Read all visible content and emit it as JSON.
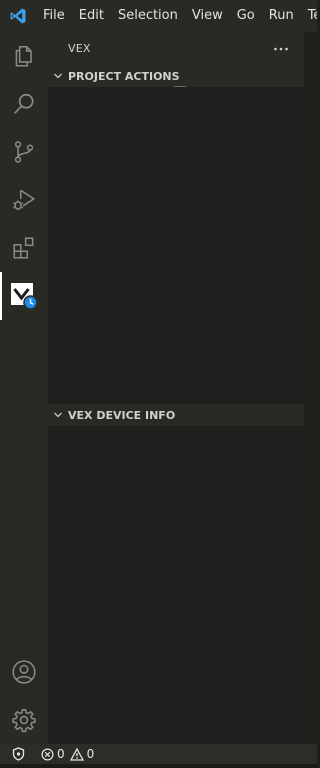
{
  "menu": {
    "items": [
      "File",
      "Edit",
      "Selection",
      "View",
      "Go",
      "Run",
      "Ter"
    ]
  },
  "activity_bar": {
    "items": [
      {
        "name": "explorer-icon"
      },
      {
        "name": "search-icon"
      },
      {
        "name": "source-control-icon"
      },
      {
        "name": "run-debug-icon"
      },
      {
        "name": "extensions-icon"
      },
      {
        "name": "vex-icon",
        "active": true
      }
    ],
    "bottom_items": [
      {
        "name": "account-icon"
      },
      {
        "name": "settings-gear-icon"
      }
    ]
  },
  "sidebar": {
    "title": "VEX",
    "sections": [
      {
        "title": "PROJECT ACTIONS",
        "expanded": true
      },
      {
        "title": "VEX DEVICE INFO",
        "expanded": true
      }
    ]
  },
  "status_bar": {
    "errors": "0",
    "warnings": "0"
  },
  "colors": {
    "accent": "#0078d4",
    "activity_bar_bg": "#2a2a25",
    "sidebar_bg": "#1f1f1d",
    "vex_badge": "#1e88e5"
  }
}
